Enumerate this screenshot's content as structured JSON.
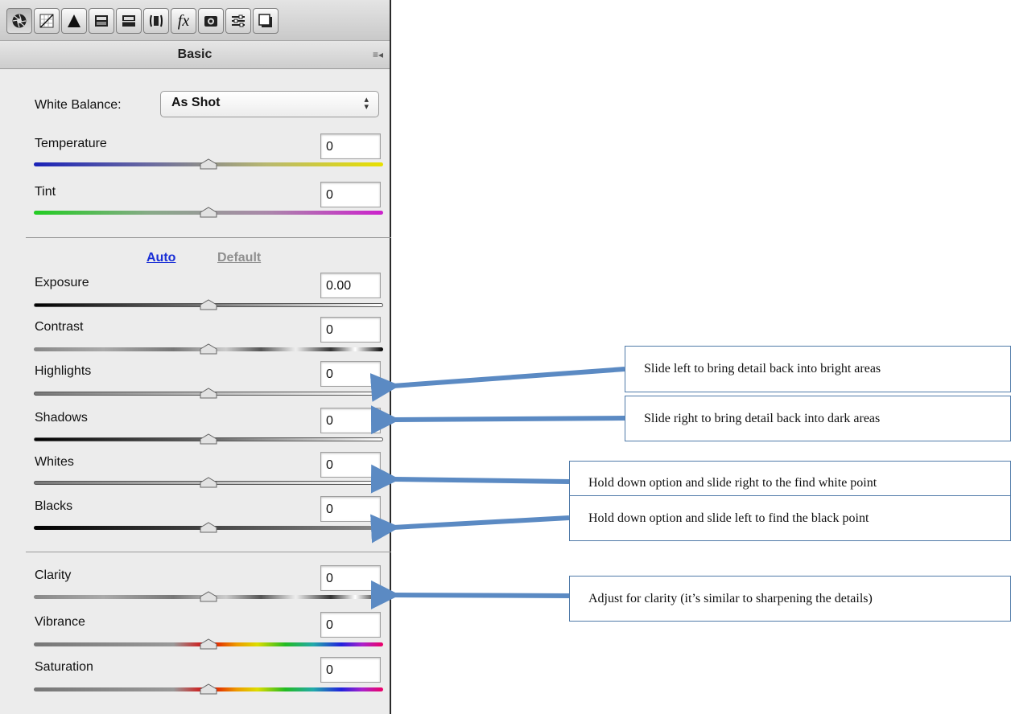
{
  "toolbar": {
    "tabs": [
      {
        "icon": "basic-aperture-icon",
        "active": true
      },
      {
        "icon": "tone-curve-icon",
        "active": false
      },
      {
        "icon": "detail-icon",
        "active": false
      },
      {
        "icon": "hsl-grayscale-icon",
        "active": false
      },
      {
        "icon": "split-toning-icon",
        "active": false
      },
      {
        "icon": "lens-corrections-icon",
        "active": false
      },
      {
        "icon": "effects-fx-icon",
        "active": false
      },
      {
        "icon": "camera-calibration-icon",
        "active": false
      },
      {
        "icon": "presets-icon",
        "active": false
      },
      {
        "icon": "snapshots-icon",
        "active": false
      }
    ],
    "fx_label": "fx"
  },
  "panel": {
    "title": "Basic",
    "menu_icon": "≡◂"
  },
  "white_balance": {
    "label": "White Balance:",
    "value": "As Shot"
  },
  "auto_link": "Auto",
  "default_link": "Default",
  "sliders": {
    "temperature": {
      "label": "Temperature",
      "value": "0",
      "position": 0.5
    },
    "tint": {
      "label": "Tint",
      "value": "0",
      "position": 0.5
    },
    "exposure": {
      "label": "Exposure",
      "value": "0.00",
      "position": 0.5
    },
    "contrast": {
      "label": "Contrast",
      "value": "0",
      "position": 0.5
    },
    "highlights": {
      "label": "Highlights",
      "value": "0",
      "position": 0.5
    },
    "shadows": {
      "label": "Shadows",
      "value": "0",
      "position": 0.5
    },
    "whites": {
      "label": "Whites",
      "value": "0",
      "position": 0.5
    },
    "blacks": {
      "label": "Blacks",
      "value": "0",
      "position": 0.5
    },
    "clarity": {
      "label": "Clarity",
      "value": "0",
      "position": 0.5
    },
    "vibrance": {
      "label": "Vibrance",
      "value": "0",
      "position": 0.5
    },
    "saturation": {
      "label": "Saturation",
      "value": "0",
      "position": 0.5
    }
  },
  "callouts": {
    "highlights": "Slide left to bring detail back into bright areas",
    "shadows": "Slide right to bring detail back into dark areas",
    "whites": "Hold down option and slide right to the find white point",
    "blacks": "Hold down option and slide left to find the black point",
    "clarity": "Adjust for clarity (it’s similar to sharpening the details)"
  },
  "colors": {
    "callout_border": "#4f7aa8",
    "arrow": "#5b8ac3",
    "auto_link": "#1a2fd6"
  }
}
